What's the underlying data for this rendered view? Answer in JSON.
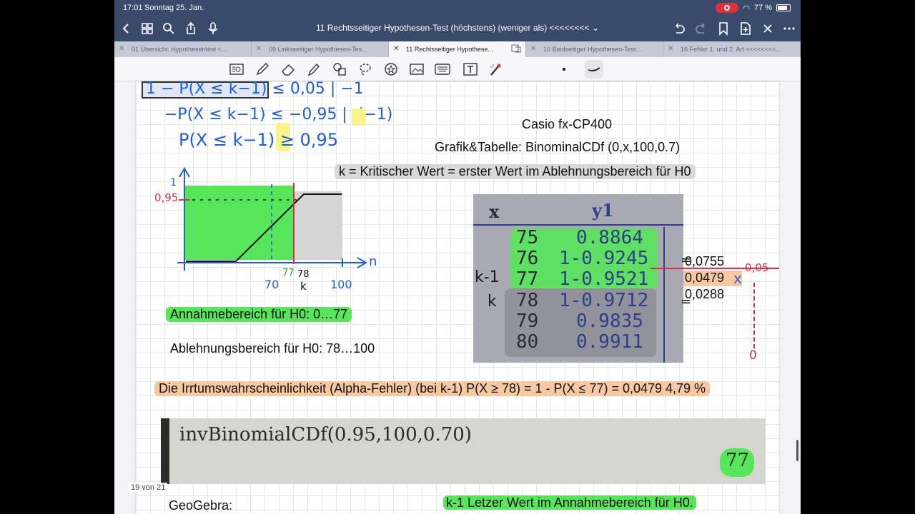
{
  "status": {
    "time": "17:01",
    "date": "Sonntag 25. Jan.",
    "battery": "77 %"
  },
  "nav": {
    "title": "11 Rechtsseitiger Hypothesen-Test  (höchstens) (weniger als) <<<<<<<< ⌄"
  },
  "tabs": [
    {
      "label": "01 Übersicht: Hypothesentest  <..."
    },
    {
      "label": "09 Linksseitiger Hypothesen-Tes..."
    },
    {
      "label": "11 Rechtsseitiger Hypothese..."
    },
    {
      "label": "10 Beidseitiger Hypothesen-Test..."
    },
    {
      "label": "16 Fehler 1. und 2. Art <<<<<<<<..."
    }
  ],
  "handwriting": {
    "line1": "1 − P(X ≤ k−1) ≤ 0,05  | −1",
    "line2": "−P(X ≤ k−1) ≤ −0,95  | ·(−1)",
    "line3": "P(X ≤ k−1) ≥ 0,95",
    "graph_y1": "1",
    "graph_y095": "0,95",
    "graph_xn": "n",
    "graph_70": "70",
    "graph_77": "77",
    "graph_78": "78",
    "graph_k": "k",
    "graph_100": "100",
    "side_k1": "k-1",
    "side_k": "k",
    "alpha_top": "0,05",
    "alpha_x": "x",
    "alpha_zero": "0",
    "eq": "="
  },
  "text": {
    "casio": "Casio fx-CP400",
    "grafik": "Grafik&Tabelle: BinominalCDf (0,x,100,0.7)",
    "kritisch": "k = Kritischer Wert = erster Wert im Ablehnungsbereich für H0",
    "annahme": "Annahmebereich für H0:      0…77",
    "ablehnung": "Ablehnungsbereich für H0: 78…100",
    "irrtum": "Die Irrtumswahrscheinlichkeit (Alpha-Fehler) (bei k-1) P(X ≥ 78) = 1 - P(X ≤ 77) = 0,0479    4,79 %",
    "v1": "0,0755",
    "v2": "0,0479",
    "v3": "0,0288",
    "geogebra": "GeoGebra:",
    "letzter": "k-1 Letzer Wert im Annahmebereich für H0."
  },
  "calc_table": {
    "header_x": "x",
    "header_y": "y1",
    "rows": [
      {
        "x": "75",
        "y": "0.8864"
      },
      {
        "x": "76",
        "y": "1-0.9245"
      },
      {
        "x": "77",
        "y": "1-0.9521"
      },
      {
        "x": "78",
        "y": "1-0.9712"
      },
      {
        "x": "79",
        "y": "0.9835"
      },
      {
        "x": "80",
        "y": "0.9911"
      }
    ]
  },
  "inv": {
    "formula": "invBinomialCDf(0.95,100,0.70)",
    "result": "77"
  },
  "page_indicator": "19 von 21",
  "colors": {
    "chrome": "#3a4a6b",
    "ink_blue": "#1f5fd6",
    "highlight_green": "#57e65a",
    "highlight_orange": "#f8c9a1",
    "highlight_gray": "#d8d8d8",
    "ink_red": "#d8304a"
  }
}
